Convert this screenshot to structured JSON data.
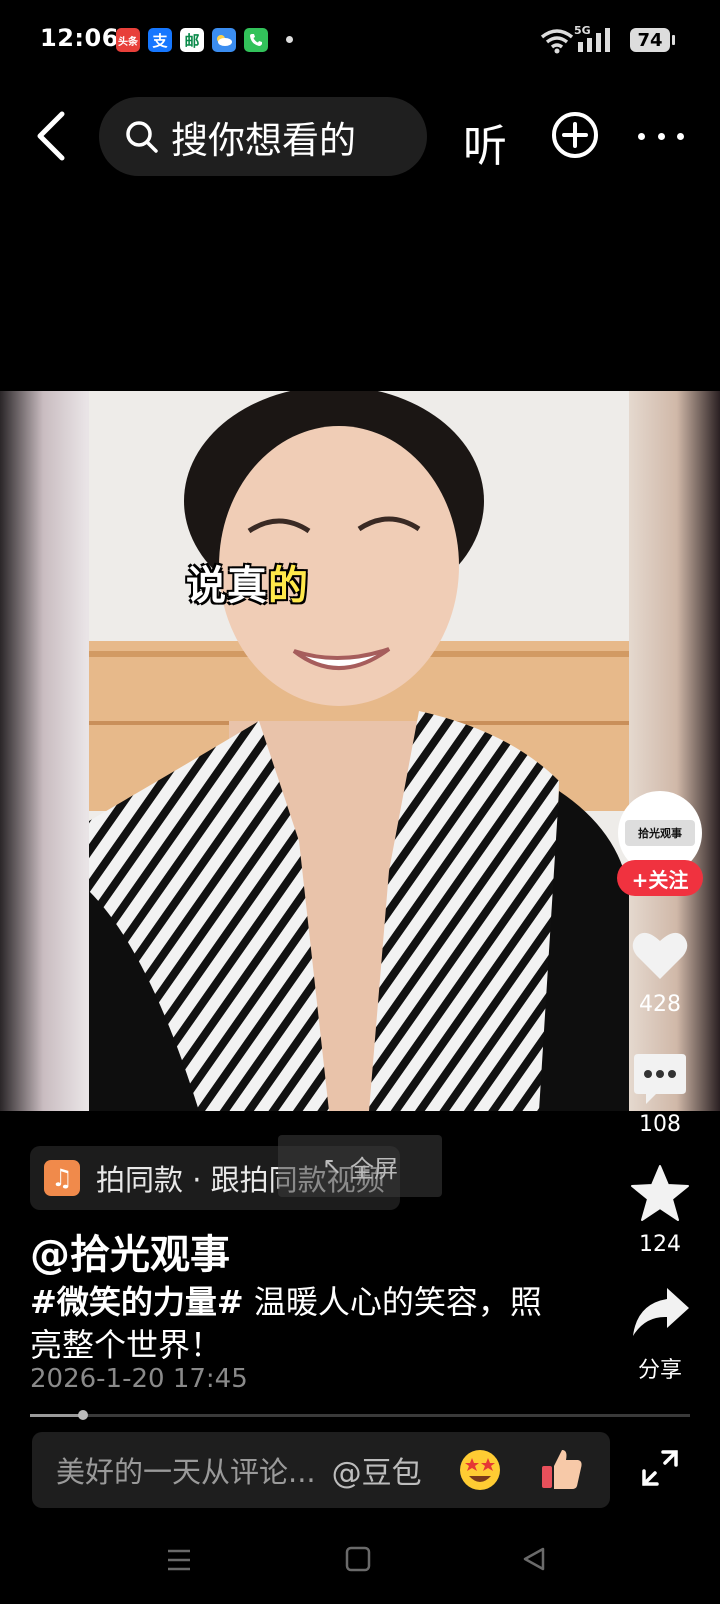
{
  "status_bar": {
    "time": "12:06",
    "apps": [
      {
        "name": "toutiao",
        "label": "头条",
        "color": "#e8403a"
      },
      {
        "name": "alipay",
        "label": "支",
        "color": "#1677ff"
      },
      {
        "name": "china-post",
        "label": "邮",
        "color": "#0a8a4a"
      },
      {
        "name": "weather",
        "label": "",
        "color": "#3b8df0"
      },
      {
        "name": "phone",
        "label": "",
        "color": "#32c25a"
      }
    ],
    "network": "5G",
    "battery": "74"
  },
  "top_bar": {
    "search_placeholder": "搜你想看的",
    "listen_label": "听"
  },
  "video": {
    "subtitle_prefix": "说真",
    "subtitle_highlight": "的"
  },
  "rail": {
    "follow_label": "+关注",
    "like_count": "428",
    "comment_count": "108",
    "favorite_count": "124",
    "share_label": "分享",
    "avatar_text": "拾光观事"
  },
  "info": {
    "music_label": "拍同款 · 跟拍同款视频",
    "fullscreen_label": "全屏",
    "author": "@拾光观事",
    "hashtag": "#微笑的力量#",
    "caption_text": " 温暖人心的笑容，照亮整个世界！",
    "post_time": "2026-1-20 17:45",
    "progress": 0.08
  },
  "comment_bar": {
    "placeholder": "美好的一天从评论...",
    "mention": "@豆包"
  },
  "icons": {
    "emoji_1": "star-struck-icon",
    "emoji_2": "thumbs-up-icon"
  }
}
